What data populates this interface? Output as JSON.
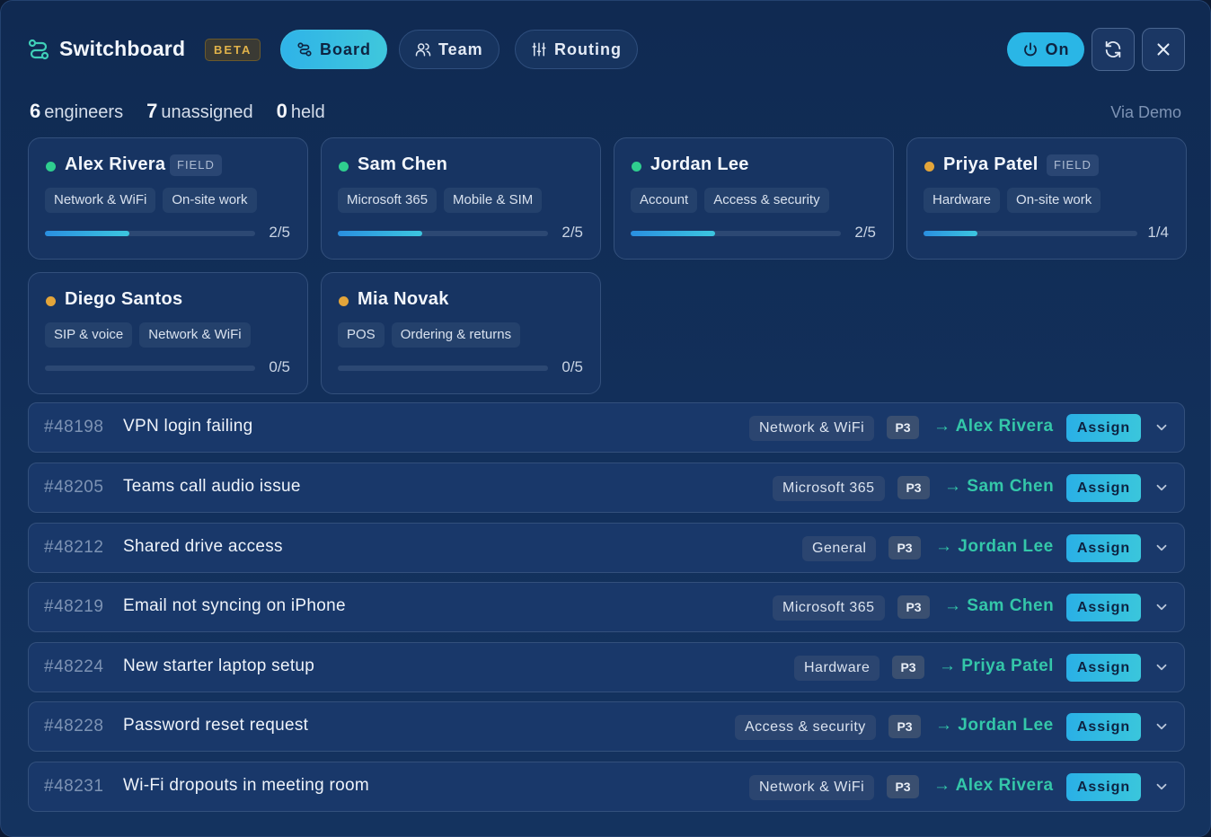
{
  "header": {
    "app_title": "Switchboard",
    "beta_badge": "BETA",
    "tabs": [
      {
        "label": "Board",
        "icon": "board-icon",
        "active": true
      },
      {
        "label": "Team",
        "icon": "team-icon",
        "active": false
      },
      {
        "label": "Routing",
        "icon": "sliders-icon",
        "active": false
      }
    ],
    "power_toggle_label": "On",
    "refresh_icon": "refresh-icon",
    "close_icon": "close-icon"
  },
  "summary": {
    "engineers_count": "6",
    "engineers_label": "engineers",
    "unassigned_count": "7",
    "unassigned_label": "unassigned",
    "held_count": "0",
    "held_label": "held",
    "via": "Via Demo"
  },
  "colors": {
    "accent": "#2ab6e6",
    "online": "#2fce8f",
    "away": "#e3a53a",
    "assignee": "#34c7a9"
  },
  "engineers": [
    {
      "name": "Alex Rivera",
      "badge": "FIELD",
      "status": "online",
      "skills": [
        "Network & WiFi",
        "On-site work"
      ],
      "load": "2/5",
      "load_fraction": 0.4
    },
    {
      "name": "Sam Chen",
      "badge": "",
      "status": "online",
      "skills": [
        "Microsoft 365",
        "Mobile & SIM"
      ],
      "load": "2/5",
      "load_fraction": 0.4
    },
    {
      "name": "Jordan Lee",
      "badge": "",
      "status": "online",
      "skills": [
        "Account",
        "Access & security"
      ],
      "load": "2/5",
      "load_fraction": 0.4
    },
    {
      "name": "Priya Patel",
      "badge": "FIELD",
      "status": "away",
      "skills": [
        "Hardware",
        "On-site work"
      ],
      "load": "1/4",
      "load_fraction": 0.25
    },
    {
      "name": "Diego Santos",
      "badge": "",
      "status": "away",
      "skills": [
        "SIP & voice",
        "Network & WiFi"
      ],
      "load": "0/5",
      "load_fraction": 0
    },
    {
      "name": "Mia Novak",
      "badge": "",
      "status": "away",
      "skills": [
        "POS",
        "Ordering & returns"
      ],
      "load": "0/5",
      "load_fraction": 0
    }
  ],
  "tickets": [
    {
      "id": "#48198",
      "subject": "VPN login failing",
      "category": "Network & WiFi",
      "priority": "P3",
      "suggested": "→ Alex Rivera",
      "action": "Assign"
    },
    {
      "id": "#48205",
      "subject": "Teams call audio issue",
      "category": "Microsoft 365",
      "priority": "P3",
      "suggested": "→ Sam Chen",
      "action": "Assign"
    },
    {
      "id": "#48212",
      "subject": "Shared drive access",
      "category": "General",
      "priority": "P3",
      "suggested": "→ Jordan Lee",
      "action": "Assign"
    },
    {
      "id": "#48219",
      "subject": "Email not syncing on iPhone",
      "category": "Microsoft 365",
      "priority": "P3",
      "suggested": "→ Sam Chen",
      "action": "Assign"
    },
    {
      "id": "#48224",
      "subject": "New starter laptop setup",
      "category": "Hardware",
      "priority": "P3",
      "suggested": "→ Priya Patel",
      "action": "Assign"
    },
    {
      "id": "#48228",
      "subject": "Password reset request",
      "category": "Access & security",
      "priority": "P3",
      "suggested": "→ Jordan Lee",
      "action": "Assign"
    },
    {
      "id": "#48231",
      "subject": "Wi-Fi dropouts in meeting room",
      "category": "Network & WiFi",
      "priority": "P3",
      "suggested": "→ Alex Rivera",
      "action": "Assign"
    }
  ]
}
